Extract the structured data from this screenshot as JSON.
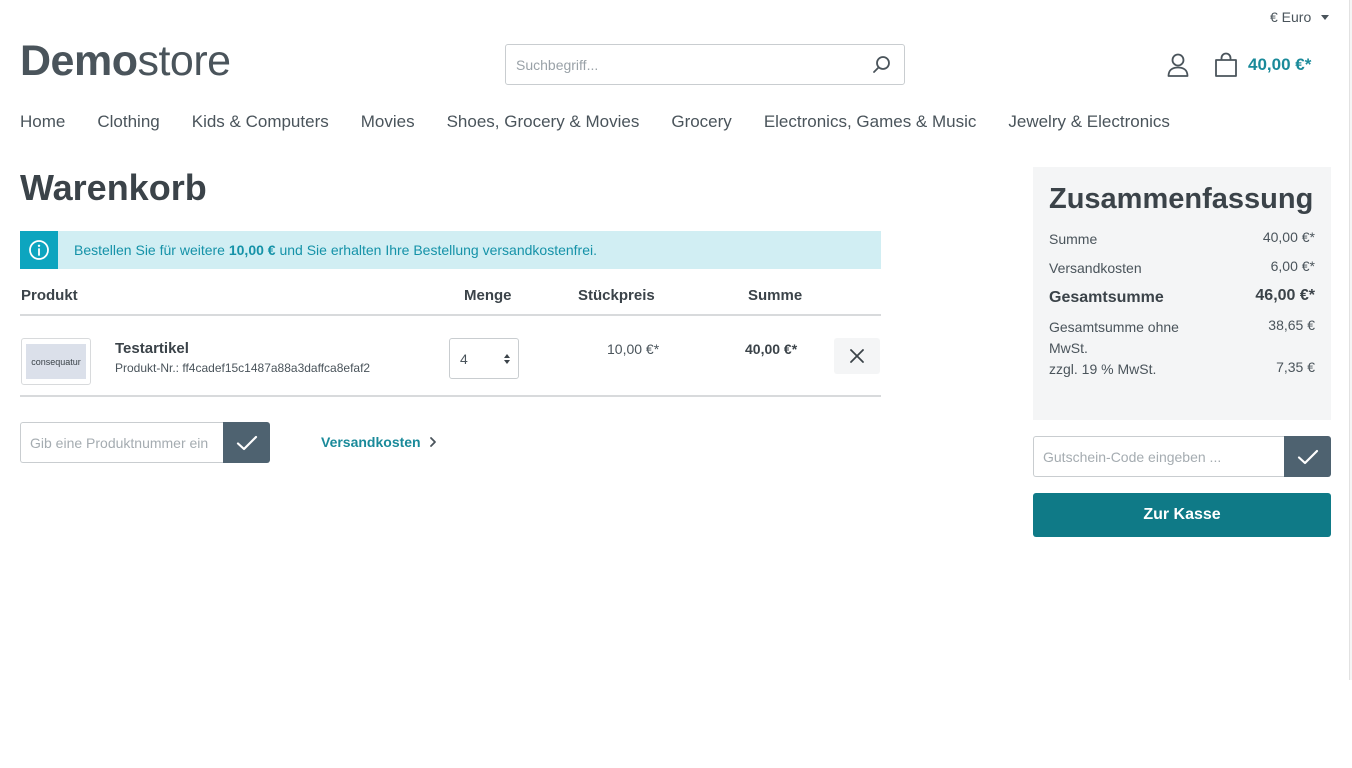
{
  "header": {
    "currency": "€ Euro",
    "logo_bold": "Demo",
    "logo_light": "store",
    "search_placeholder": "Suchbegriff...",
    "cart_total": "40,00 €*"
  },
  "nav": {
    "items": [
      "Home",
      "Clothing",
      "Kids & Computers",
      "Movies",
      "Shoes, Grocery & Movies",
      "Grocery",
      "Electronics, Games & Music",
      "Jewelry & Electronics"
    ]
  },
  "cart": {
    "title": "Warenkorb",
    "alert": {
      "before": "Bestellen Sie für weitere ",
      "amount": "10,00 €",
      "after": " und Sie erhalten Ihre Bestellung versandkostenfrei."
    },
    "columns": {
      "product": "Produkt",
      "quantity": "Menge",
      "unit_price": "Stückpreis",
      "total": "Summe"
    },
    "items": [
      {
        "thumb_text": "consequatur",
        "name": "Testartikel",
        "number": "Produkt-Nr.: ff4cadef15c1487a88a3daffca8efaf2",
        "quantity": "4",
        "unit_price": "10,00 €*",
        "total": "40,00 €*"
      }
    ],
    "product_number_placeholder": "Gib eine Produktnummer ein",
    "shipping_link": "Versandkosten"
  },
  "summary": {
    "title": "Zusammenfassung",
    "subtotal_label": "Summe",
    "subtotal_value": "40,00 €*",
    "shipping_label": "Versandkosten",
    "shipping_value": "6,00 €*",
    "grand_total_label": "Gesamtsumme",
    "grand_total_value": "46,00 €*",
    "net_label": "Gesamtsumme ohne MwSt.",
    "net_value": "38,65 €",
    "tax_label": "zzgl. 19 % MwSt.",
    "tax_value": "7,35 €",
    "voucher_placeholder": "Gutschein-Code eingeben ...",
    "checkout_label": "Zur Kasse"
  },
  "icons": {
    "search": "search-icon",
    "account": "user-icon",
    "cart": "bag-icon",
    "info": "info-icon",
    "check": "check-icon",
    "remove": "close-icon",
    "chevron": "chevron-right-icon"
  },
  "colors": {
    "accent": "#1a8a9a",
    "checkout": "#0f7a87",
    "info_bg": "#d1eef3",
    "info_icon": "#0da5bf",
    "submit_btn": "#4e6270"
  }
}
